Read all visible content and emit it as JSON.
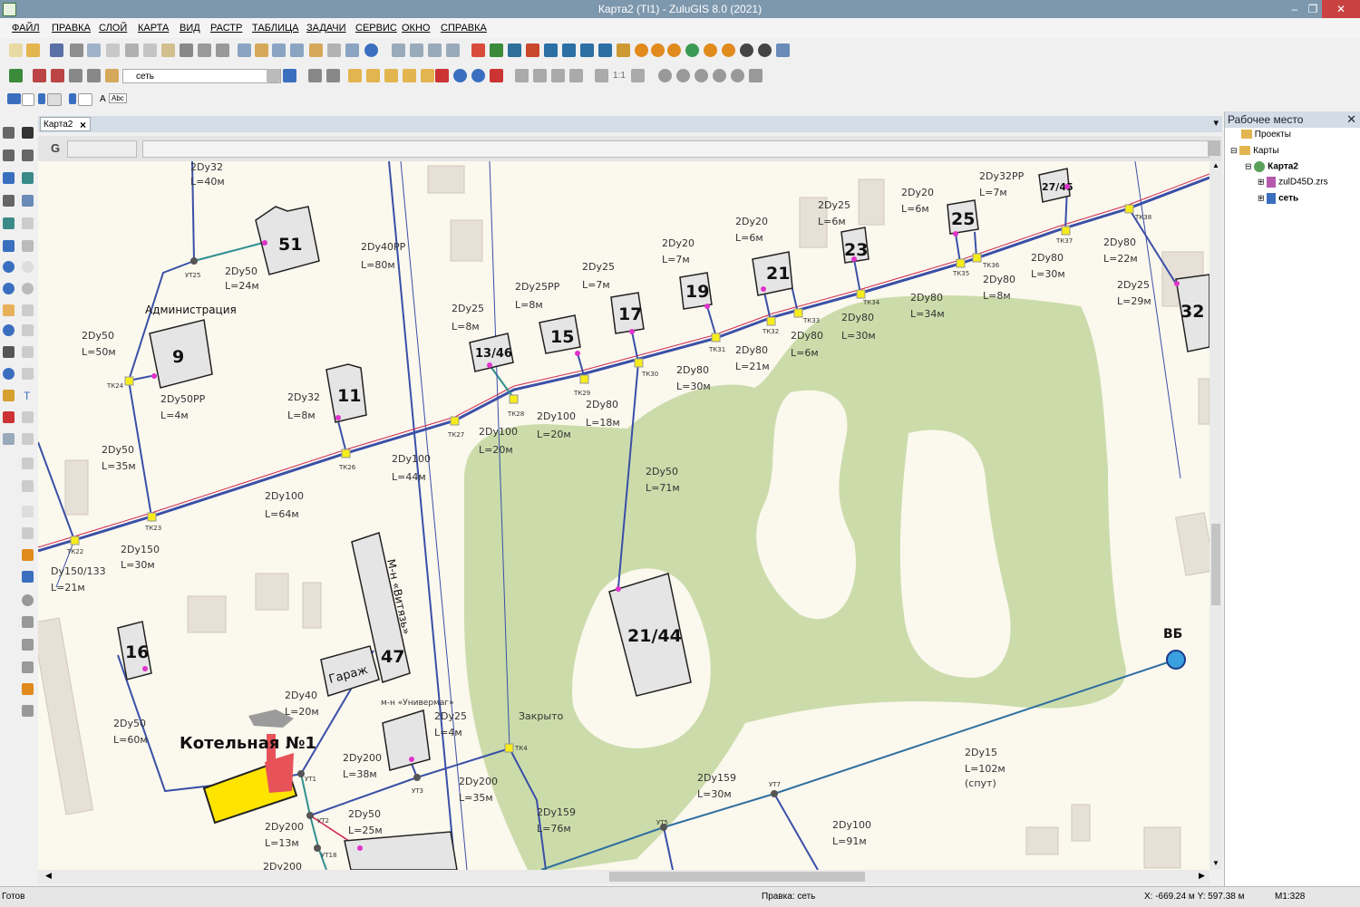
{
  "window": {
    "title": "Карта2 (ТІ1) - ZuluGIS 8.0 (2021)"
  },
  "menu": [
    "ФАЙЛ",
    "ПРАВКА",
    "СЛОЙ",
    "КАРТА",
    "ВИД",
    "РАСТР",
    "ТАБЛИЦА",
    "ЗАДАЧИ",
    "СЕРВИС",
    "ОКНО",
    "СПРАВКА"
  ],
  "toolbar": {
    "layer_combo": "сеть",
    "scale_label": "1:1",
    "font_label": "Abc"
  },
  "document_tab": {
    "label": "Карта2"
  },
  "gbar": {
    "label": "G"
  },
  "workspace": {
    "title": "Рабочее место",
    "tree": [
      {
        "label": "Проекты"
      },
      {
        "label": "Карты"
      },
      {
        "label": "Карта2"
      },
      {
        "label": "zulD45D.zrs"
      },
      {
        "label": "сеть"
      }
    ]
  },
  "status": {
    "ready": "Готов",
    "mode": "Правка: сеть",
    "coords": "X: -669.24 м Y: 597.38 м",
    "scale": "M1:328"
  },
  "map": {
    "buildings": [
      {
        "label": "51"
      },
      {
        "label": "9"
      },
      {
        "label": "11"
      },
      {
        "label": "13/46"
      },
      {
        "label": "15"
      },
      {
        "label": "17"
      },
      {
        "label": "19"
      },
      {
        "label": "21"
      },
      {
        "label": "23"
      },
      {
        "label": "25"
      },
      {
        "label": "27/45"
      },
      {
        "label": "32"
      },
      {
        "label": "21/44"
      },
      {
        "label": "16"
      },
      {
        "label": "47"
      },
      {
        "label": "Гараж"
      },
      {
        "label": "М-н «Витязь»"
      }
    ],
    "nodes": [
      "УТ25",
      "ТК24",
      "ТК22",
      "ТК23",
      "ТК26",
      "ТК27",
      "ТК28",
      "ТК29",
      "ТК30",
      "ТК31",
      "ТК32",
      "ТК33",
      "ТК34",
      "ТК35",
      "ТК36",
      "ТК37",
      "ТК38",
      "ТК4",
      "УТ1",
      "УТ2",
      "УТ18",
      "УТ3",
      "УТ5",
      "УТ7"
    ],
    "pipes": [
      {
        "d": "2Dy32",
        "l": "L=40м"
      },
      {
        "d": "2Dy50",
        "l": "L=24м"
      },
      {
        "d": "2Dy40PP",
        "l": "L=80м"
      },
      {
        "d": "2Dy50",
        "l": "L=50м"
      },
      {
        "d": "2Dy50PP",
        "l": "L=4м"
      },
      {
        "d": "2Dy50",
        "l": "L=35м"
      },
      {
        "d": "2Dy150",
        "l": "L=30м"
      },
      {
        "d": "Dy150/133",
        "l": "L=21м"
      },
      {
        "d": "2Dy100",
        "l": "L=64м"
      },
      {
        "d": "2Dy32",
        "l": "L=8м"
      },
      {
        "d": "2Dy100",
        "l": "L=44м"
      },
      {
        "d": "2Dy25",
        "l": "L=8м"
      },
      {
        "d": "2Dy25PP",
        "l": "L=8м"
      },
      {
        "d": "2Dy25",
        "l": "L=7м"
      },
      {
        "d": "2Dy100",
        "l": "L=20м"
      },
      {
        "d": "2Dy100",
        "l": "L=20м"
      },
      {
        "d": "2Dy80",
        "l": "L=18м"
      },
      {
        "d": "2Dy20",
        "l": "L=7м"
      },
      {
        "d": "2Dy80",
        "l": "L=30м"
      },
      {
        "d": "2Dy20",
        "l": "L=6м"
      },
      {
        "d": "2Dy80",
        "l": "L=21м"
      },
      {
        "d": "2Dy25",
        "l": "L=6м"
      },
      {
        "d": "2Dy80",
        "l": "L=6м"
      },
      {
        "d": "2Dy80",
        "l": "L=30м"
      },
      {
        "d": "2Dy20",
        "l": "L=6м"
      },
      {
        "d": "2Dy80",
        "l": "L=34м"
      },
      {
        "d": "2Dy32PP",
        "l": "L=7м"
      },
      {
        "d": "2Dy80",
        "l": "L=8м"
      },
      {
        "d": "2Dy80",
        "l": "L=30м"
      },
      {
        "d": "2Dy80",
        "l": "L=22м"
      },
      {
        "d": "2Dy25",
        "l": "L=29м"
      },
      {
        "d": "2Dy50",
        "l": "L=71м"
      },
      {
        "d": "2Dy50",
        "l": "L=60м"
      },
      {
        "d": "2Dy40",
        "l": "L=20м"
      },
      {
        "d": "2Dy200",
        "l": "L=38м"
      },
      {
        "d": "2Dy25",
        "l": "L=4м"
      },
      {
        "d": "2Dy200",
        "l": "L=35м"
      },
      {
        "d": "2Dy50",
        "l": "L=25м"
      },
      {
        "d": "2Dy200",
        "l": "L=13м"
      },
      {
        "d": "2Dy159",
        "l": "L=76м"
      },
      {
        "d": "2Dy159",
        "l": "L=30м"
      },
      {
        "d": "2Dy15",
        "l": "L=102м"
      },
      {
        "d": "2Dy100",
        "l": "L=91м"
      }
    ],
    "texts": {
      "admin": "Администрация",
      "boiler": "Котельная №1",
      "closed": "Закрыто",
      "vb": "ВБ",
      "sput": "(спут)",
      "univermag": "м-н «Универмаг»",
      "dy200_bottom": "2Dy200"
    }
  },
  "colors": {
    "titlebar": "#7d97ad",
    "map_bg": "#fbf8ee",
    "park": "#cbdcaa",
    "node": "#f6ec1c",
    "boiler": "#ffe400",
    "pipe": "#3a4fa7"
  }
}
